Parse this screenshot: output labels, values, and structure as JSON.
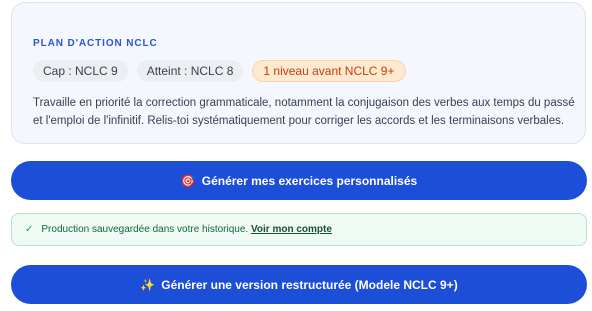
{
  "plan": {
    "title": "PLAN D'ACTION NCLC",
    "chips": {
      "cap": "Cap : NCLC 9",
      "atteint": "Atteint : NCLC 8",
      "gap": "1 niveau avant NCLC 9+"
    },
    "text": "Travaille en priorité la correction grammaticale, notamment la conjugaison des verbes aux temps du passé et l'emploi de l'infinitif. Relis-toi systématiquement pour corriger les accords et les terminaisons verbales."
  },
  "actions": {
    "exercises_label": "Générer mes exercices personnalisés",
    "exercises_icon": "🎯",
    "restructure_label": "Générer une version restructurée (Modele NCLC 9+)",
    "restructure_icon": "✨"
  },
  "notice": {
    "check": "✓",
    "text": "Production sauvegardée dans votre historique.",
    "link": "Voir mon compte"
  },
  "colors": {
    "accent": "#1d4ed8",
    "success_bg": "#effaf4",
    "warning_bg": "#fde8d0"
  }
}
